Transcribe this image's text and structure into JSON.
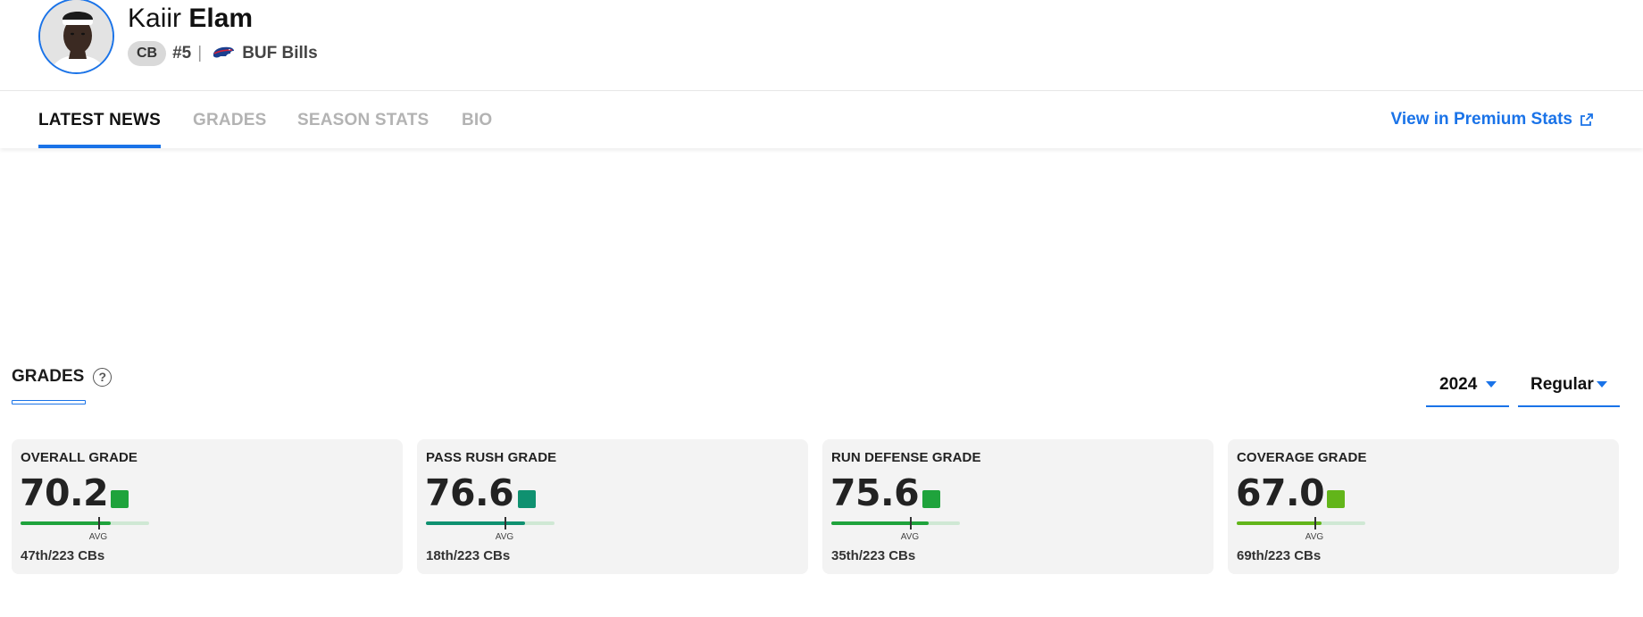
{
  "player": {
    "first_name": "Kaiir",
    "last_name": "Elam",
    "position": "CB",
    "jersey": "#5",
    "separator": "|",
    "team": "BUF Bills",
    "avatar_icon": "player-headshot",
    "team_logo_icon": "bills-logo"
  },
  "tabs": [
    {
      "label": "LATEST NEWS",
      "active": true
    },
    {
      "label": "GRADES",
      "active": false
    },
    {
      "label": "SEASON STATS",
      "active": false
    },
    {
      "label": "BIO",
      "active": false
    }
  ],
  "premium_link": {
    "label": "View in Premium Stats",
    "icon": "external-link-icon"
  },
  "grades_section": {
    "title": "GRADES",
    "help_icon": "?",
    "year_select": "2024",
    "type_select": "Regular"
  },
  "grade_cards": [
    {
      "label": "OVERALL GRADE",
      "value": "70.2",
      "color": "#1fa33c",
      "percentile_fill": 0.7,
      "avg_label": "AVG",
      "rank": "47th/223 CBs"
    },
    {
      "label": "PASS RUSH GRADE",
      "value": "76.6",
      "color": "#0f9170",
      "percentile_fill": 0.77,
      "avg_label": "AVG",
      "rank": "18th/223 CBs"
    },
    {
      "label": "RUN DEFENSE GRADE",
      "value": "75.6",
      "color": "#1fa33c",
      "percentile_fill": 0.76,
      "avg_label": "AVG",
      "rank": "35th/223 CBs"
    },
    {
      "label": "COVERAGE GRADE",
      "value": "67.0",
      "color": "#62b51a",
      "percentile_fill": 0.66,
      "avg_label": "AVG",
      "rank": "69th/223 CBs"
    }
  ],
  "colors": {
    "accent": "#1a73e8",
    "card_bg": "#f3f3f3"
  }
}
